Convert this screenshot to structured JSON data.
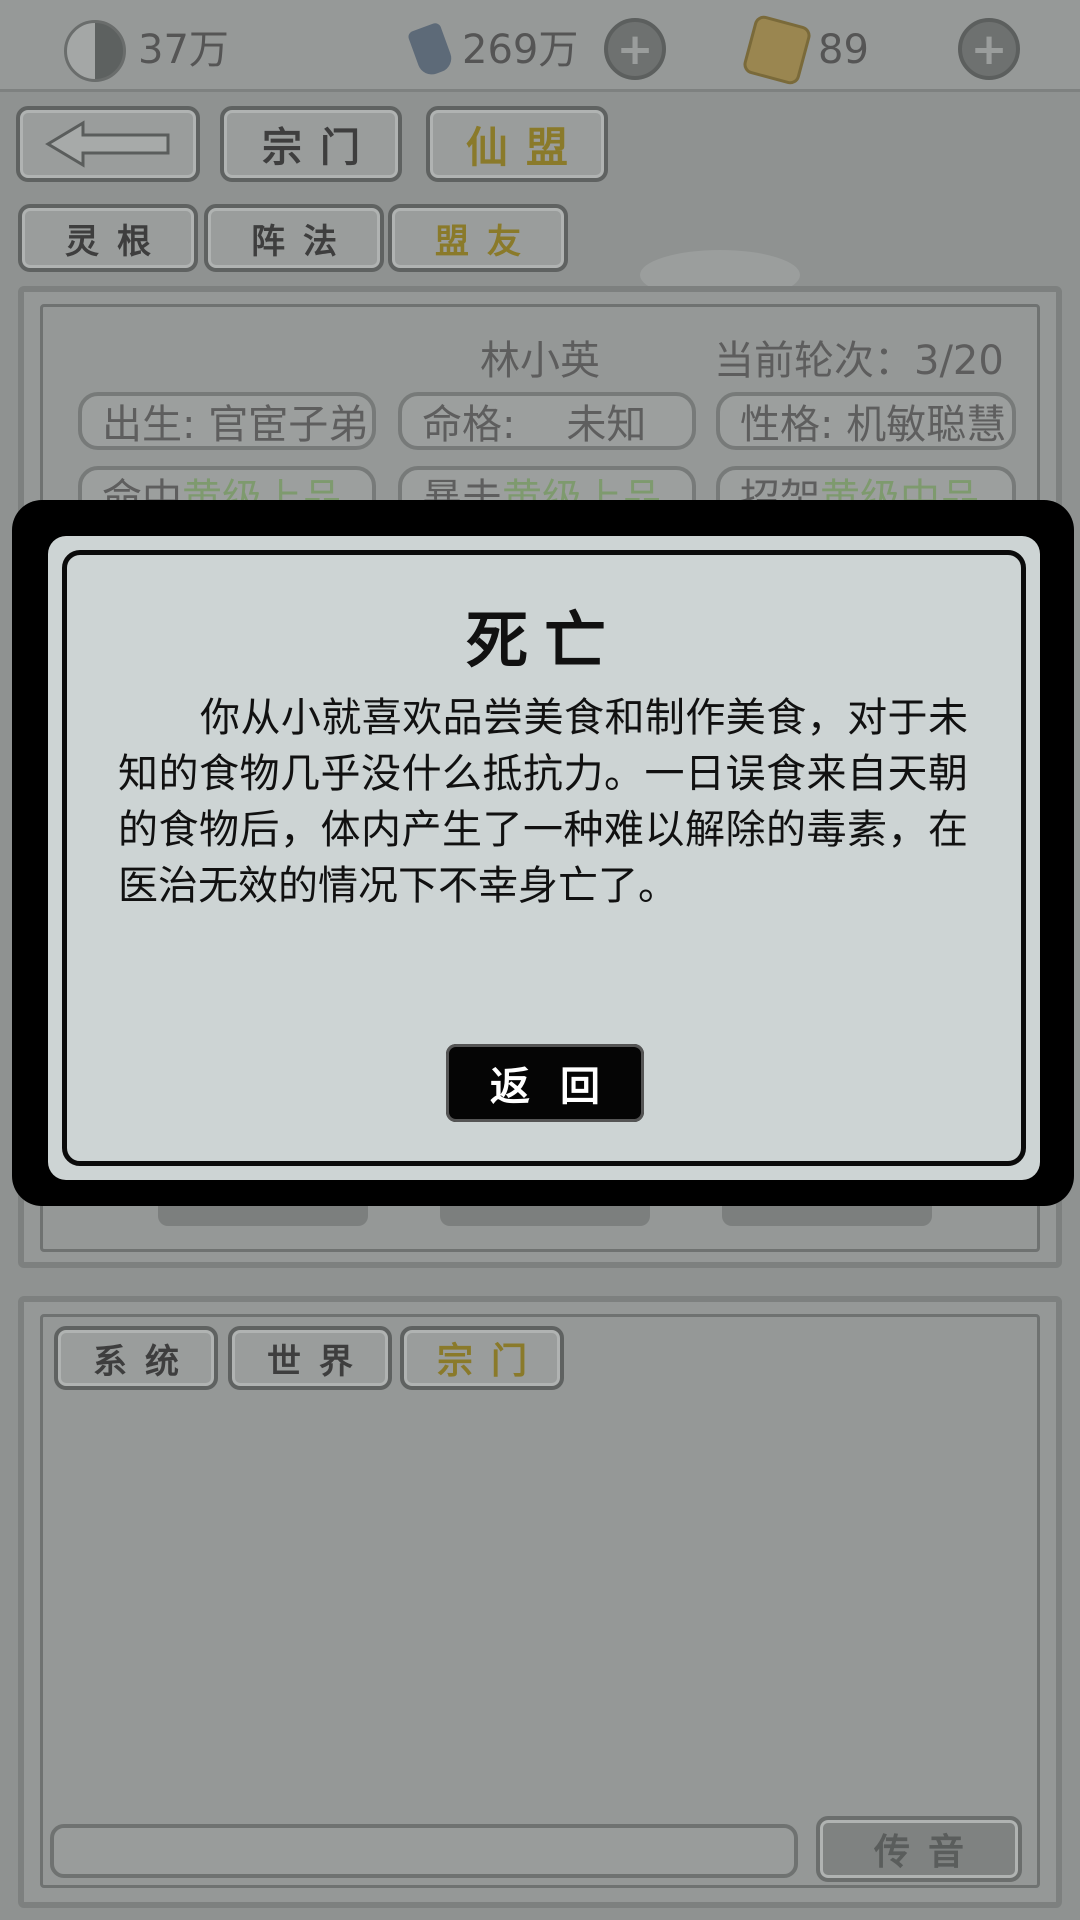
{
  "topbar": {
    "yinyang_value": "37万",
    "crystal_value": "269万",
    "token_value": "89",
    "icons": [
      "yinyang-icon",
      "crystal-icon",
      "token-icon",
      "plus-icon"
    ]
  },
  "nav": {
    "back_label": "",
    "tab_sect": "宗门",
    "tab_alliance": "仙盟"
  },
  "subtabs": {
    "spirit_root": "灵根",
    "formation": "阵法",
    "ally": "盟友"
  },
  "character": {
    "name": "林小英",
    "round_label": "当前轮次：3/20",
    "birth": "出生: 官宦子弟",
    "fate": "命格:    未知",
    "personality": "性格: 机敏聪慧",
    "hit_label": "命中",
    "hit_value": "黄级上品",
    "crit_label": "暴击",
    "crit_value": "黄级上品",
    "parry_label": "招架",
    "parry_value": "黄级中品"
  },
  "chat": {
    "tab_system": "系统",
    "tab_world": "世界",
    "tab_sect": "宗门",
    "input_value": "",
    "send_label": "传音"
  },
  "modal": {
    "title": "死亡",
    "body": "你从小就喜欢品尝美食和制作美食，对于未知的食物几乎没什么抵抗力。一日误食来自天朝的食物后，体内产生了一种难以解除的毒素，在医治无效的情况下不幸身亡了。",
    "button": "返回"
  },
  "colors": {
    "overlay_gray": "#8f9291",
    "modal_bg": "#cdd4d4",
    "modal_ink": "#000000",
    "active_tab_text": "#8a7a2a"
  }
}
